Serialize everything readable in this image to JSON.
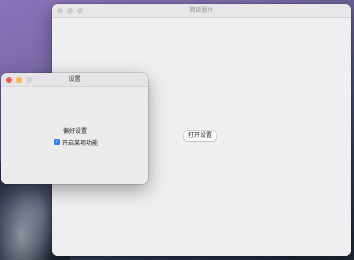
{
  "desktop": {
    "colors": {
      "accent": "#2f7cf6",
      "close": "#ec5f57",
      "minimize": "#f2bd3c",
      "zoom": "#d0cfd3",
      "inactive_light": "#cfcdd0"
    }
  },
  "main_window": {
    "title": "開啟圖片",
    "open_button_label": "打开设置"
  },
  "settings_window": {
    "title": "设置",
    "section_label": "偏好设置",
    "checkbox_label": "开启某项功能",
    "checkbox_checked": true,
    "check_glyph": "✓"
  }
}
